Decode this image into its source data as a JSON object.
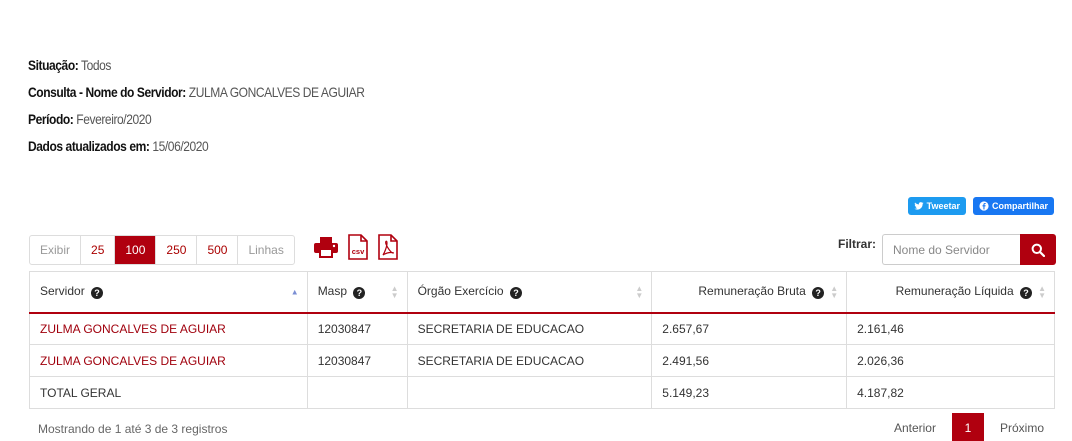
{
  "info": {
    "situacao_label": "Situação:",
    "situacao_value": "Todos",
    "consulta_label": "Consulta - Nome do Servidor:",
    "consulta_value": "ZULMA GONCALVES DE AGUIAR",
    "periodo_label": "Período:",
    "periodo_value": "Fevereiro/2020",
    "atualizados_label": "Dados atualizados em:",
    "atualizados_value": "15/06/2020"
  },
  "share": {
    "tweet_label": "Tweetar",
    "facebook_label": "Compartilhar"
  },
  "length_menu": {
    "prefix": "Exibir",
    "options": [
      "25",
      "100",
      "250",
      "500"
    ],
    "selected": "100",
    "suffix": "Linhas"
  },
  "exports": {
    "print_icon": "print-icon",
    "csv_icon": "csv-icon",
    "pdf_icon": "pdf-icon"
  },
  "filter": {
    "label": "Filtrar:",
    "placeholder": "Nome do Servidor",
    "value": ""
  },
  "table": {
    "headers": [
      "Servidor",
      "Masp",
      "Órgão Exercício",
      "Remuneração Bruta",
      "Remuneração Líquida"
    ],
    "rows": [
      [
        "ZULMA GONCALVES DE AGUIAR",
        "12030847",
        "SECRETARIA DE EDUCACAO",
        "2.657,67",
        "2.161,46"
      ],
      [
        "ZULMA GONCALVES DE AGUIAR",
        "12030847",
        "SECRETARIA DE EDUCACAO",
        "2.491,56",
        "2.026,36"
      ],
      [
        "TOTAL GERAL",
        "",
        "",
        "5.149,23",
        "4.187,82"
      ]
    ]
  },
  "footer": {
    "info": "Mostrando de 1 até 3 de 3 registros",
    "prev": "Anterior",
    "current_page": "1",
    "next": "Próximo"
  },
  "colors": {
    "accent": "#b0000f",
    "link": "#a0000d",
    "twitter": "#1d9bf0",
    "facebook": "#1877f2"
  }
}
